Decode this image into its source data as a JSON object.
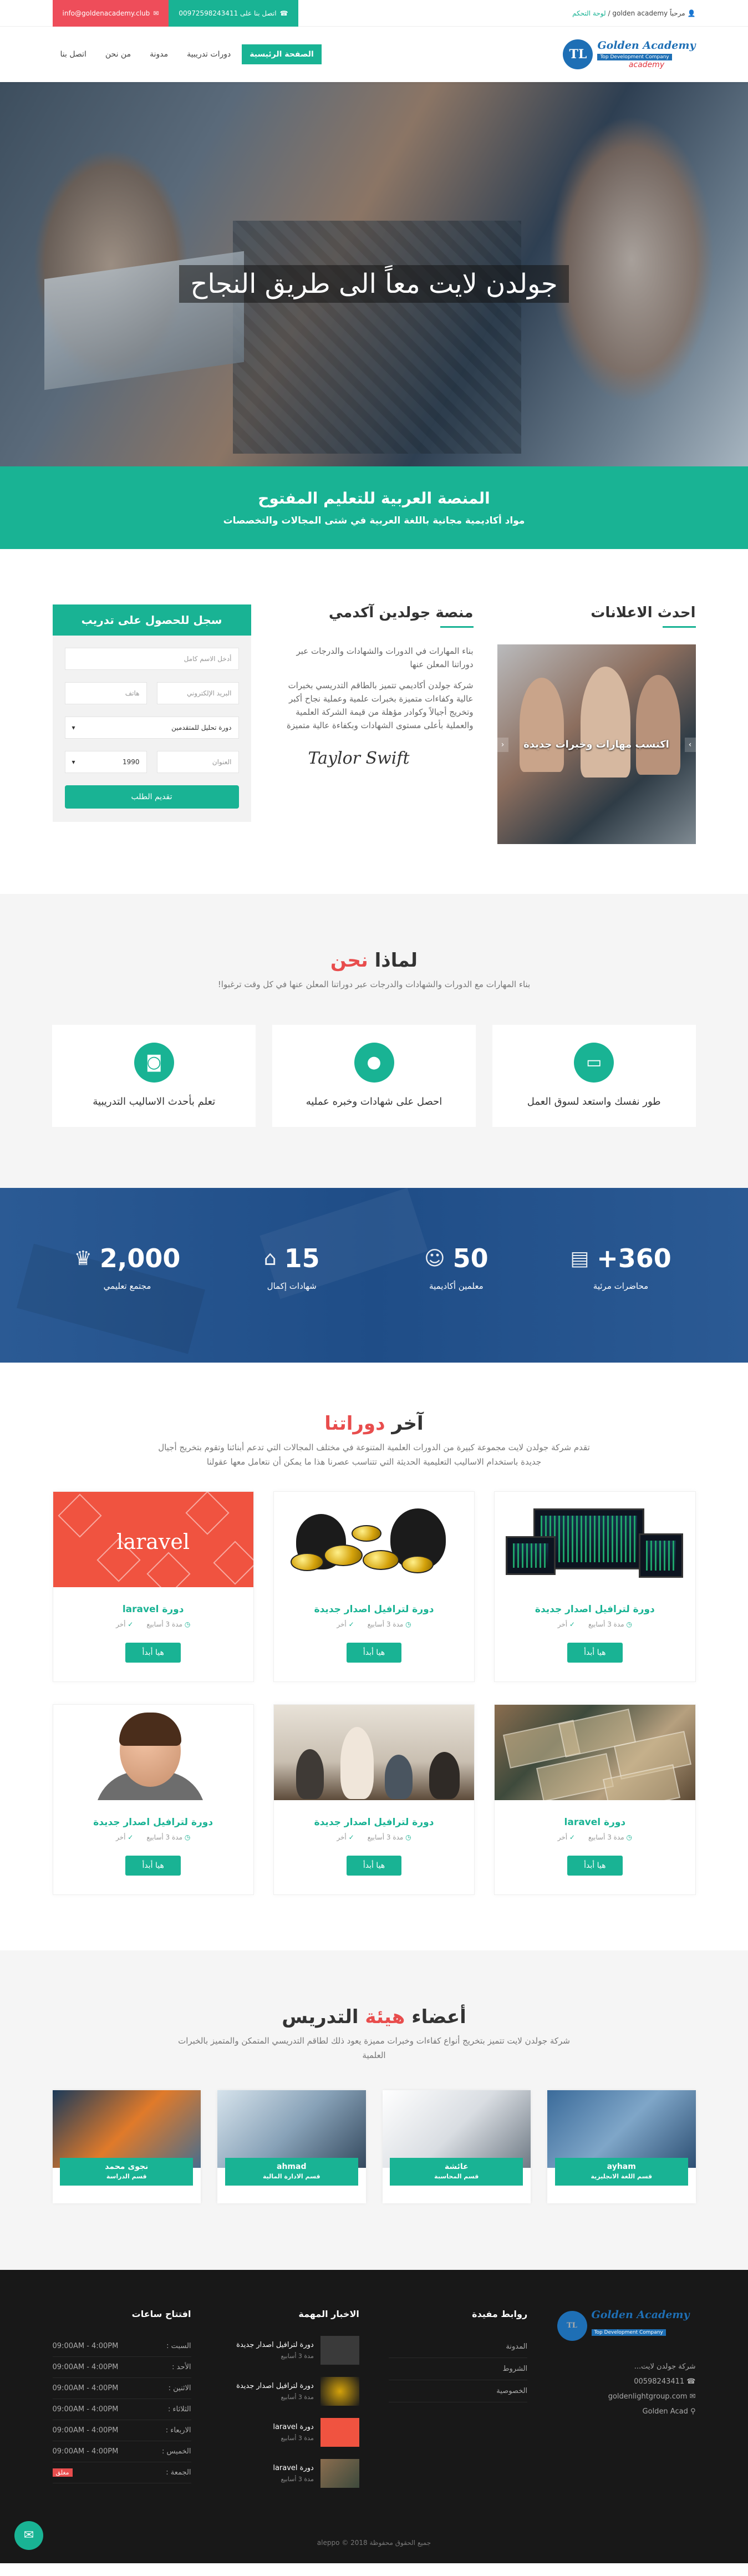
{
  "topbar": {
    "welcome_prefix": "مرحباً",
    "welcome_site": "golden academy",
    "control_panel": "لوحة التحكم",
    "phone": "اتصل بنا على 00972598243411",
    "email": "info@goldenacademy.club"
  },
  "logo": {
    "line1": "Golden Academy",
    "line2": "Top Development Company",
    "line3": "academy"
  },
  "menu": [
    "الصفحة الرئيسية",
    "دورات تدريبية",
    "مدونة",
    "من نحن",
    "اتصل بنا"
  ],
  "hero": {
    "title": "جولدن لايت معاً الى طريق النجاح"
  },
  "banner": {
    "title": "المنصة العربية للتعليم المفتوح",
    "subtitle": "مواد أكاديمية مجانية باللغة العربية في شتى المجالات والتخصصات"
  },
  "announcements": {
    "title": "احدث الاعلانات",
    "slide_caption": "اكتسب مهارات وخبرات جديدة"
  },
  "about": {
    "title": "منصة جولدين آكدمي",
    "p1": "بناء المهارات في الدورات والشهادات والدرجات عبر دوراتنا المعلن عنها",
    "p2": "شركة جولدن أكاديمي تتميز بالطاقم التدريسي بخبرات عالية وكفاءات متميزة بخبرات علمية وعملية نجاح أكبر وتخريج أجيالاً وكوادر مؤهلة من قيمة الشركة العلمية والعملية بأعلى مستوى الشهادات وبكفاءة عالية متميزة",
    "signature": "Taylor Swift"
  },
  "form": {
    "title": "سجل للحصول على تدريب",
    "name_ph": "أدخل الاسم كامل",
    "email_ph": "البريد الإلكتروني",
    "phone_ph": "هاتف",
    "course_select": "دورة تحليل للمتقدمين",
    "address_ph": "العنوان",
    "year": "1990",
    "submit": "تقديم الطلب"
  },
  "why": {
    "title_a": "لماذا",
    "title_b": "نحن",
    "subtitle": "بناء المهارات مع الدورات والشهادات والدرجات عبر دوراتنا المعلن عنها في كل وقت ترغبوا!",
    "boxes": [
      {
        "icon": "monitor-icon",
        "text": "طور نفسك واستعد لسوق العمل"
      },
      {
        "icon": "user-icon",
        "text": "احصل على شهادات وخبره عمليه"
      },
      {
        "icon": "money-icon",
        "text": "تعلم بأحدث الاساليب التدريبية"
      }
    ]
  },
  "stats": [
    {
      "num": "360+",
      "label": "محاضرات مرئية",
      "icon": "book-icon"
    },
    {
      "num": "50",
      "label": "معلمين أكاديمية",
      "icon": "people-icon"
    },
    {
      "num": "15",
      "label": "شهادات إكمال",
      "icon": "graduation-cap-icon"
    },
    {
      "num": "2,000",
      "label": "مجتمع تعليمي",
      "icon": "trophy-icon"
    }
  ],
  "courses": {
    "title_a": "آخر",
    "title_b": "دوراتنا",
    "subtitle": "تقدم شركة جولدن لايت مجموعة كبيرة من الدورات العلمية المتنوعة في مختلف المجالات التي تدعم أبنائنا وتقوم بتخريج أجيال جديدة باستخدام الاساليب التعليمية الحديثة التي تتناسب عصرنا هذا ما يمكن أن نتعامل معها عقولنا",
    "duration": "مدة 3 أسابيع",
    "level": "أخر",
    "btn": "هيا أبدأ",
    "items": [
      {
        "title": "دورة لترافيل اصدار جديدة",
        "img": "trade"
      },
      {
        "title": "دورة لترافيل اصدار جديدة",
        "img": "gold"
      },
      {
        "title": "دورة laravel",
        "img": "laravel"
      },
      {
        "title": "دورة laravel",
        "img": "money"
      },
      {
        "title": "دورة لترافيل اصدار جديدة",
        "img": "class"
      },
      {
        "title": "دورة لترافيل اصدار جديدة",
        "img": "person"
      }
    ]
  },
  "instructors": {
    "title_a": "أعضاء",
    "title_b": "هيئة",
    "title_c": "التدريس",
    "subtitle": "شركة جولدن لايت تتميز بتخريج أنواع كفاءات وخبرات مميزة يعود ذلك لطاقم التدريسي المتمكن والمتميز بالخبرات العلمية",
    "items": [
      {
        "name": "ayham",
        "dept": "قسم اللغة الانجليزية"
      },
      {
        "name": "عائشة",
        "dept": "قسم المحاسبة"
      },
      {
        "name": "ahmad",
        "dept": "قسم الادارة المالية"
      },
      {
        "name": "نجوى محمد",
        "dept": "قسم الدراسة"
      }
    ]
  },
  "footer": {
    "company": "شركة جولدن لايت...",
    "phone": "00598243411",
    "email": "goldenlightgroup.com",
    "place": "Golden Acad",
    "links_title": "روابط مفيدة",
    "links": [
      "المدونة",
      "الشروط",
      "الخصوصية"
    ],
    "news_title": "الاخبار المهمة",
    "news": [
      {
        "t": "دورة لترافيل اصدار جديدة",
        "d": "مدة 3 أسابيع"
      },
      {
        "t": "دورة لترافيل اصدار جديدة",
        "d": "مدة 3 أسابيع"
      },
      {
        "t": "دورة laravel",
        "d": "مدة 3 أسابيع"
      },
      {
        "t": "دورة laravel",
        "d": "مدة 3 أسابيع"
      }
    ],
    "hours_title": "افتتاح ساعات",
    "hours": [
      {
        "day": "السبت :",
        "time": "09:00AM - 4:00PM"
      },
      {
        "day": "الأحد :",
        "time": "09:00AM - 4:00PM"
      },
      {
        "day": "الاثنين :",
        "time": "09:00AM - 4:00PM"
      },
      {
        "day": "الثلاثاء :",
        "time": "09:00AM - 4:00PM"
      },
      {
        "day": "الاربعاء :",
        "time": "09:00AM - 4:00PM"
      },
      {
        "day": "الخميس :",
        "time": "09:00AM - 4:00PM"
      },
      {
        "day": "الجمعة :",
        "time": "مغلق"
      }
    ],
    "copyright": "جميع الحقوق محفوظة 2018 © aleppo"
  }
}
